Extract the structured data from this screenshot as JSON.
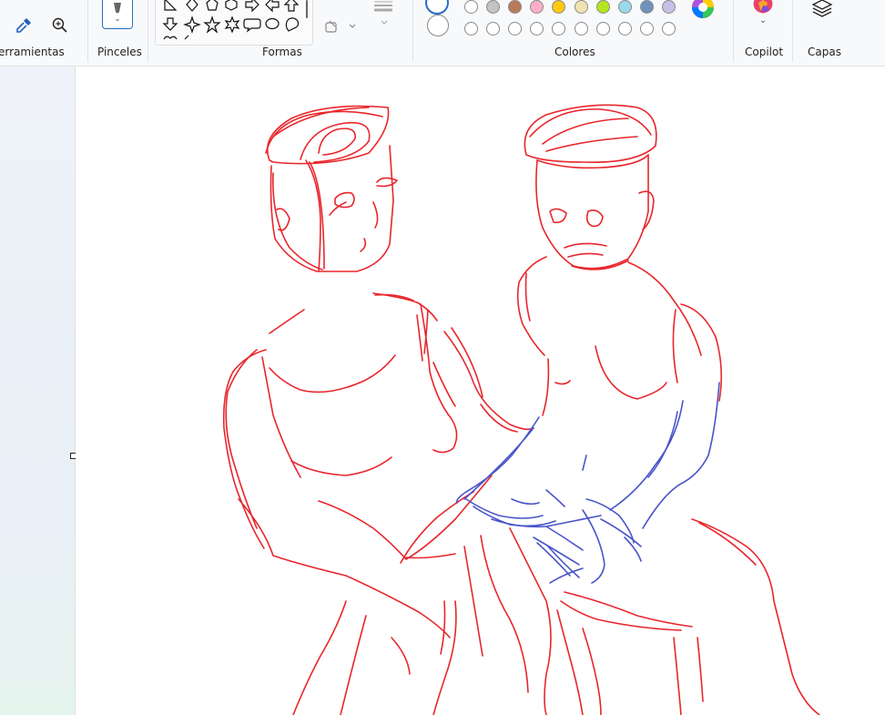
{
  "ribbon": {
    "groups": {
      "tools": "Herramientas",
      "brushes": "Pinceles",
      "shapes": "Formas",
      "colors": "Colores",
      "copilot": "Copilot",
      "layers": "Capas"
    }
  },
  "icons": {
    "eyedropper": "eyedropper-icon",
    "zoom": "zoom-in-icon",
    "brush": "brush-icon",
    "color_picker": "color-wheel-icon",
    "copilot": "copilot-icon",
    "layers": "layers-icon"
  },
  "palette": {
    "row1": [
      "#ffffff",
      "#c3c3c3",
      "#b97a57",
      "#ffaec9",
      "#ffc90e",
      "#efe4b0",
      "#b5e61d",
      "#99d9ea",
      "#7092be",
      "#c8bfe7"
    ],
    "row2_empty_count": 10
  },
  "drawing": {
    "colors": {
      "red": "#e8262c",
      "blue": "#4a55c8"
    }
  }
}
